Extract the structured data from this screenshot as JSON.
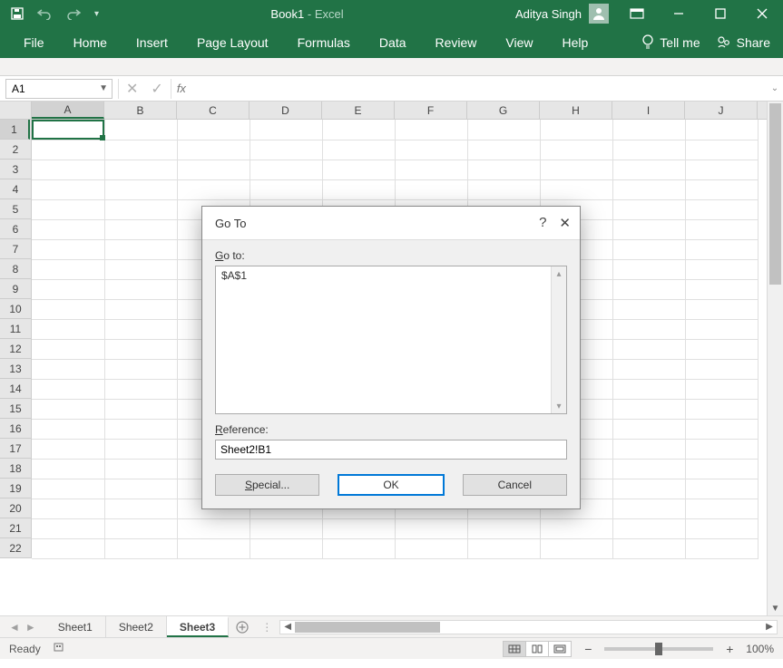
{
  "titlebar": {
    "doc_title": "Book1",
    "app_suffix": "  -  Excel",
    "user_name": "Aditya Singh"
  },
  "ribbon": {
    "tabs": [
      "File",
      "Home",
      "Insert",
      "Page Layout",
      "Formulas",
      "Data",
      "Review",
      "View",
      "Help"
    ],
    "tellme": "Tell me",
    "share": "Share"
  },
  "formula": {
    "namebox_value": "A1",
    "fx_label": "fx",
    "formula_value": ""
  },
  "grid": {
    "columns": [
      "A",
      "B",
      "C",
      "D",
      "E",
      "F",
      "G",
      "H",
      "I",
      "J"
    ],
    "rows": [
      "1",
      "2",
      "3",
      "4",
      "5",
      "6",
      "7",
      "8",
      "9",
      "10",
      "11",
      "12",
      "13",
      "14",
      "15",
      "16",
      "17",
      "18",
      "19",
      "20",
      "21",
      "22"
    ],
    "selected_col_index": 0,
    "selected_row_index": 0
  },
  "sheets": {
    "tabs": [
      "Sheet1",
      "Sheet2",
      "Sheet3"
    ],
    "active_index": 2
  },
  "status": {
    "ready": "Ready",
    "zoom": "100%"
  },
  "dialog": {
    "title": "Go To",
    "goto_label": "Go to:",
    "goto_items": [
      "$A$1"
    ],
    "reference_label": "Reference:",
    "reference_value": "Sheet2!B1",
    "btn_special": "Special...",
    "btn_ok": "OK",
    "btn_cancel": "Cancel"
  }
}
